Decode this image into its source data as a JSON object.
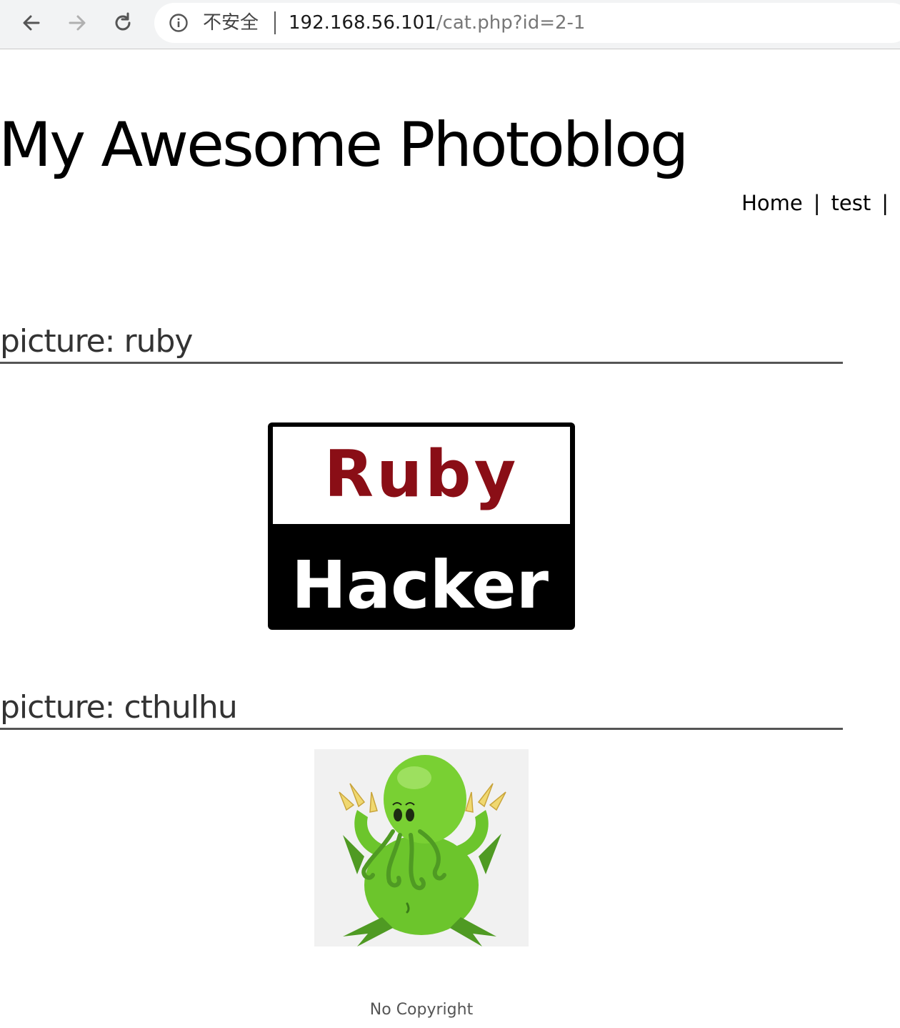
{
  "browser": {
    "security_label": "不安全",
    "url_host": "192.168.56.101",
    "url_path": "/cat.php?id=2-1"
  },
  "site": {
    "title": "My Awesome Photoblog"
  },
  "menu": {
    "items": [
      {
        "label": "Home"
      },
      {
        "label": "test"
      }
    ],
    "separator": "|"
  },
  "pictures": [
    {
      "heading": "picture: ruby",
      "image_top_text": "Ruby",
      "image_bottom_text": "Hacker"
    },
    {
      "heading": "picture: cthulhu"
    }
  ],
  "footer": {
    "text": "No Copyright"
  },
  "colors": {
    "chrome_bg": "#f2f3f4",
    "ruby_red": "#8a0e16"
  }
}
